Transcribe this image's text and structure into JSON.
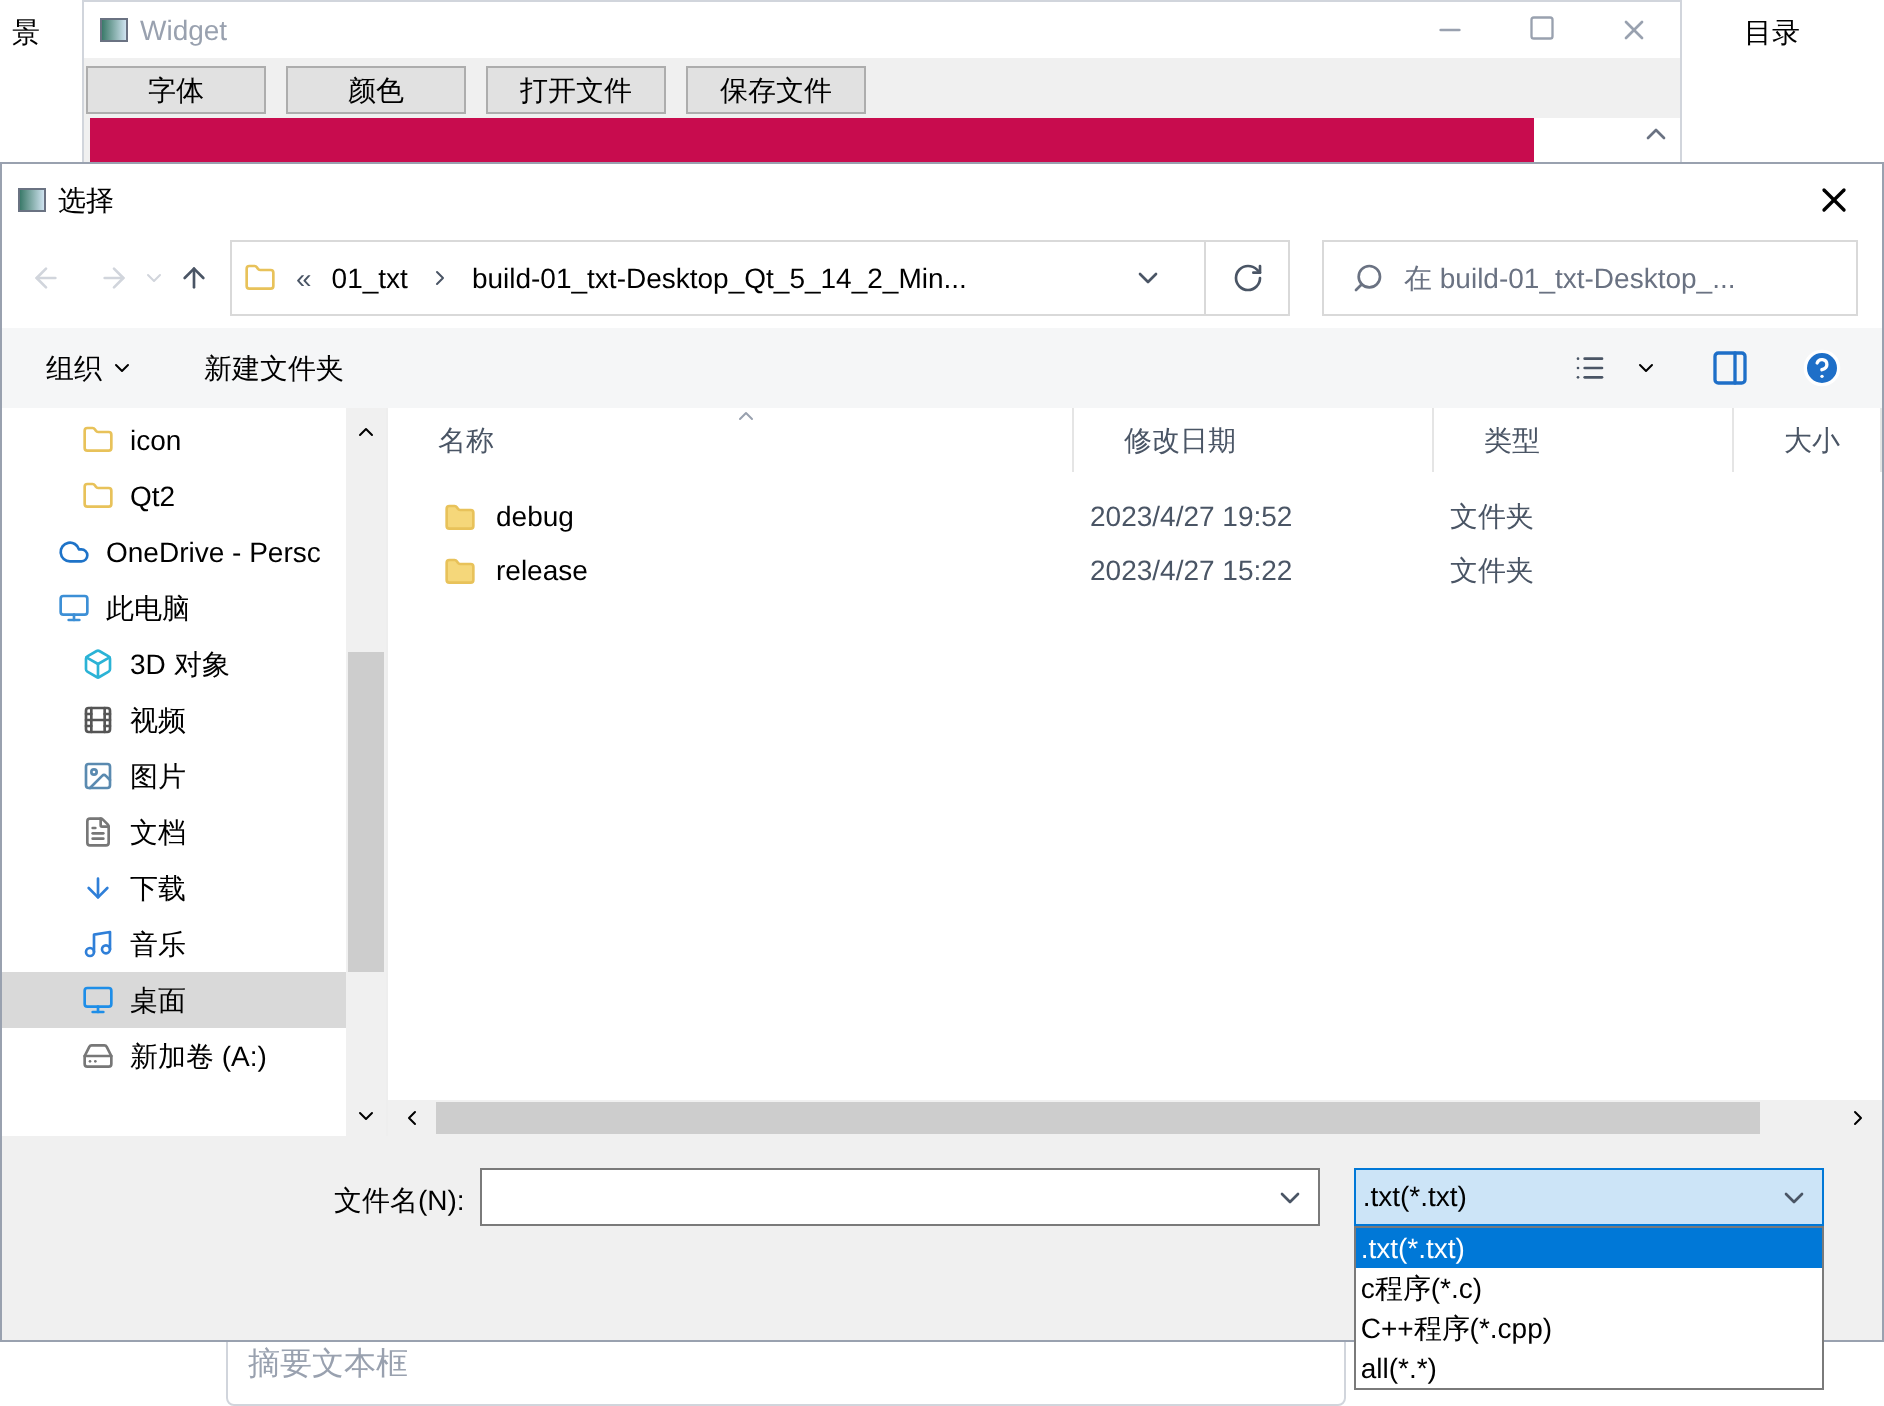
{
  "background_page": {
    "left_text": "景",
    "right_text": "目录",
    "summary_field": {
      "placeholder": "摘要文本框"
    }
  },
  "widget_window": {
    "title": "Widget",
    "buttons": [
      "字体",
      "颜色",
      "打开文件",
      "保存文件"
    ]
  },
  "dialog": {
    "title": "选择",
    "address_bar": {
      "overflow": "«",
      "path": [
        "01_txt",
        "build-01_txt-Desktop_Qt_5_14_2_Min..."
      ]
    },
    "search": {
      "placeholder": "在 build-01_txt-Desktop_..."
    },
    "toolbar": {
      "organize": "组织",
      "new_folder": "新建文件夹"
    },
    "nav_pane": {
      "items": [
        {
          "label": "icon",
          "kind": "folder",
          "selected": false
        },
        {
          "label": "Qt2",
          "kind": "folder",
          "selected": false
        },
        {
          "label": "OneDrive - Persc",
          "kind": "cloud",
          "selected": false
        },
        {
          "label": "此电脑",
          "kind": "pc",
          "selected": false,
          "children": [
            {
              "label": "3D 对象",
              "kind": "cube",
              "selected": false
            },
            {
              "label": "视频",
              "kind": "video",
              "selected": false
            },
            {
              "label": "图片",
              "kind": "picture",
              "selected": false
            },
            {
              "label": "文档",
              "kind": "document",
              "selected": false
            },
            {
              "label": "下载",
              "kind": "download",
              "selected": false
            },
            {
              "label": "音乐",
              "kind": "music",
              "selected": false
            },
            {
              "label": "桌面",
              "kind": "desktop",
              "selected": true
            },
            {
              "label": "新加卷 (A:)",
              "kind": "drive",
              "selected": false
            }
          ]
        }
      ]
    }
  },
  "file_list": {
    "columns": [
      "名称",
      "修改日期",
      "类型",
      "大小"
    ],
    "rows": [
      {
        "name": "debug",
        "modified": "2023/4/27 19:52",
        "type": "文件夹"
      },
      {
        "name": "release",
        "modified": "2023/4/27 15:22",
        "type": "文件夹"
      }
    ]
  },
  "file_name": {
    "label": "文件名(N):"
  },
  "file_type": {
    "value": ".txt(*.txt)",
    "options": [
      {
        "label": ".txt(*.txt)",
        "selected": true
      },
      {
        "label": "c程序(*.c)",
        "selected": false
      },
      {
        "label": "C++程序(*.cpp)",
        "selected": false
      },
      {
        "label": "all(*.*)",
        "selected": false
      }
    ]
  }
}
